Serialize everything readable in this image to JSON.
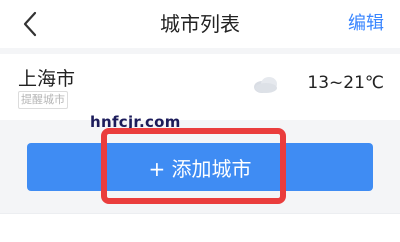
{
  "header": {
    "title": "城市列表",
    "edit_label": "编辑",
    "back_icon": "chevron-left-icon"
  },
  "city_list": [
    {
      "name": "上海市",
      "tag": "提醒城市",
      "weather_icon": "cloud-icon",
      "temp_range": "13~21℃"
    }
  ],
  "watermark": "hnfcjr.com",
  "add_button": {
    "label": "+ 添加城市"
  },
  "colors": {
    "accent": "#3f8cf3",
    "link": "#3a86ff",
    "highlight": "#ea3d3d",
    "background": "#f4f5f7"
  }
}
